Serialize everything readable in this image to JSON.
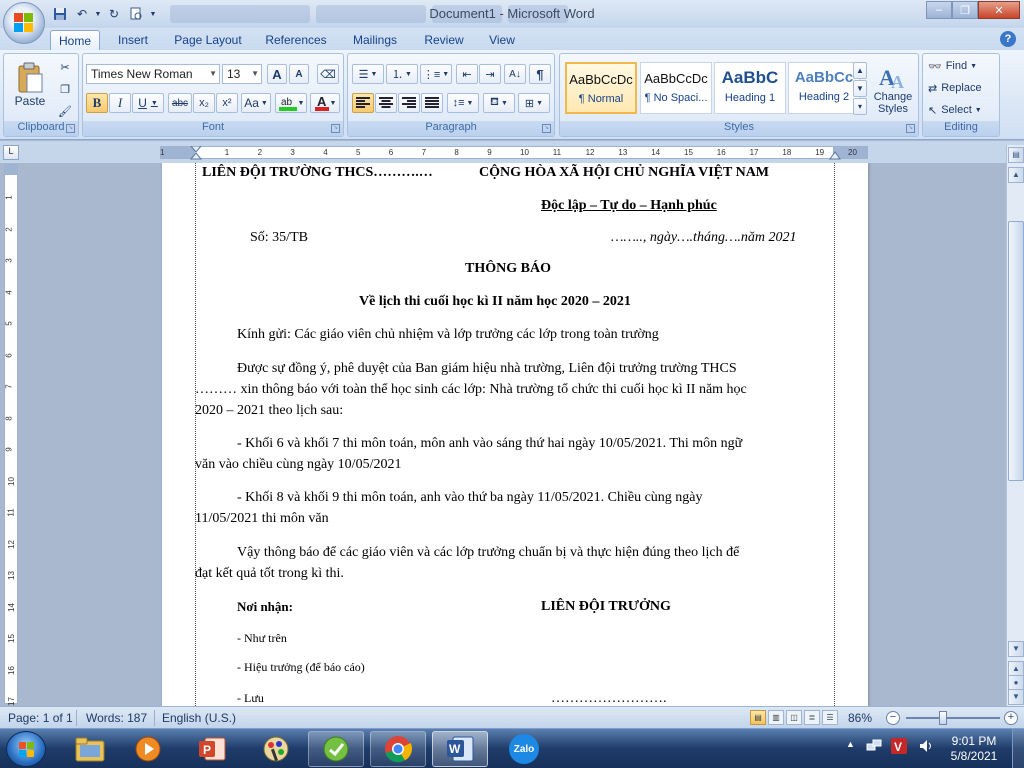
{
  "window": {
    "title": "Document1 - Microsoft Word",
    "minimize": "–",
    "maximize": "❐",
    "close": "✕"
  },
  "ribbon_tabs": [
    "Home",
    "Insert",
    "Page Layout",
    "References",
    "Mailings",
    "Review",
    "View"
  ],
  "active_tab": "Home",
  "clipboard": {
    "paste": "Paste",
    "group": "Clipboard"
  },
  "font": {
    "name": "Times New Roman",
    "size": "13",
    "group": "Font",
    "bold": "B",
    "italic": "I",
    "underline": "U",
    "strike": "abc",
    "subscript": "x₂",
    "superscript": "x²",
    "change_case": "Aa",
    "grow": "A",
    "shrink": "A",
    "clear": "⌫"
  },
  "paragraph": {
    "group": "Paragraph",
    "show_marks": "¶",
    "sort": "A↓"
  },
  "styles": {
    "group": "Styles",
    "items": [
      {
        "sample": "AaBbCcDc",
        "name": "¶ Normal"
      },
      {
        "sample": "AaBbCcDc",
        "name": "¶ No Spaci..."
      },
      {
        "sample": "AaBbC",
        "name": "Heading 1"
      },
      {
        "sample": "AaBbCc",
        "name": "Heading 2"
      }
    ],
    "change_styles": "Change Styles"
  },
  "editing": {
    "group": "Editing",
    "find": "Find",
    "replace": "Replace",
    "select": "Select"
  },
  "ruler": {
    "h_ticks": [
      "1",
      "1",
      "2",
      "3",
      "4",
      "5",
      "6",
      "7",
      "8",
      "9",
      "10",
      "11",
      "12",
      "13",
      "14",
      "15",
      "16",
      "17",
      "18",
      "19",
      "20"
    ],
    "v_ticks": [
      "1",
      "2",
      "3",
      "4",
      "5",
      "6",
      "7",
      "8",
      "9",
      "10",
      "11",
      "12",
      "13",
      "14",
      "15",
      "16",
      "17"
    ]
  },
  "document": {
    "header_left": "LIÊN ĐỘI TRƯỜNG THCS……….…",
    "header_right": "CỘNG HÒA XÃ HỘI CHỦ NGHĨA VIỆT NAM",
    "motto": "Độc lập – Tự do – Hạnh phúc",
    "number": "Số: 35/TB",
    "date": "…….., ngày….tháng….năm 2021",
    "title": "THÔNG BÁO",
    "subtitle": "Về lịch thi cuối học kì II năm học 2020 – 2021",
    "greeting": "Kính gửi: Các giáo viên chủ nhiệm và lớp trưởng các lớp trong toàn trường",
    "para1_l1": "Được sự đồng ý, phê duyệt của Ban giám hiệu nhà trường, Liên đội trưởng trường THCS",
    "para1_l2": "……… xin thông báo với toàn thể học sinh các lớp: Nhà trường tổ chức thi cuối học kì II năm học",
    "para1_l3": "2020 – 2021 theo lịch sau:",
    "item1_l1": "- Khối 6 và khối 7 thi môn toán, môn anh vào sáng thứ hai ngày 10/05/2021. Thi môn ngữ",
    "item1_l2": "văn vào chiều cùng ngày 10/05/2021",
    "item2_l1": "- Khối 8 và khối 9 thi môn toán, anh vào thứ ba ngày 11/05/2021. Chiều cùng ngày",
    "item2_l2": "11/05/2021 thi môn văn",
    "closing_l1": "Vậy thông báo để các giáo viên và các lớp trưởng chuẩn bị và thực hiện đúng theo lịch để",
    "closing_l2": "đạt kết quả tốt trong kì thi.",
    "recipients_label": "Nơi nhận:",
    "signer": "LIÊN ĐỘI TRƯỞNG",
    "recipients": [
      "- Như trên",
      "- Hiệu trưởng (để báo cáo)",
      "- Lưu"
    ],
    "signature_line": "……………………."
  },
  "status": {
    "page": "Page: 1 of 1",
    "words": "Words: 187",
    "language": "English (U.S.)",
    "zoom": "86%",
    "zoom_level_percent": 86
  },
  "taskbar": {
    "time": "9:01 PM",
    "date": "5/8/2021",
    "apps": [
      "file-explorer",
      "media-player",
      "powerpoint",
      "paint",
      "green-app",
      "chrome",
      "word",
      "zalo"
    ],
    "zalo_label": "Zalo"
  },
  "colors": {
    "ribbon_text": "#15428b",
    "highlight": "#f8c96e",
    "font_color_bar": "#e02020",
    "highlight_bar": "#22cc22"
  }
}
